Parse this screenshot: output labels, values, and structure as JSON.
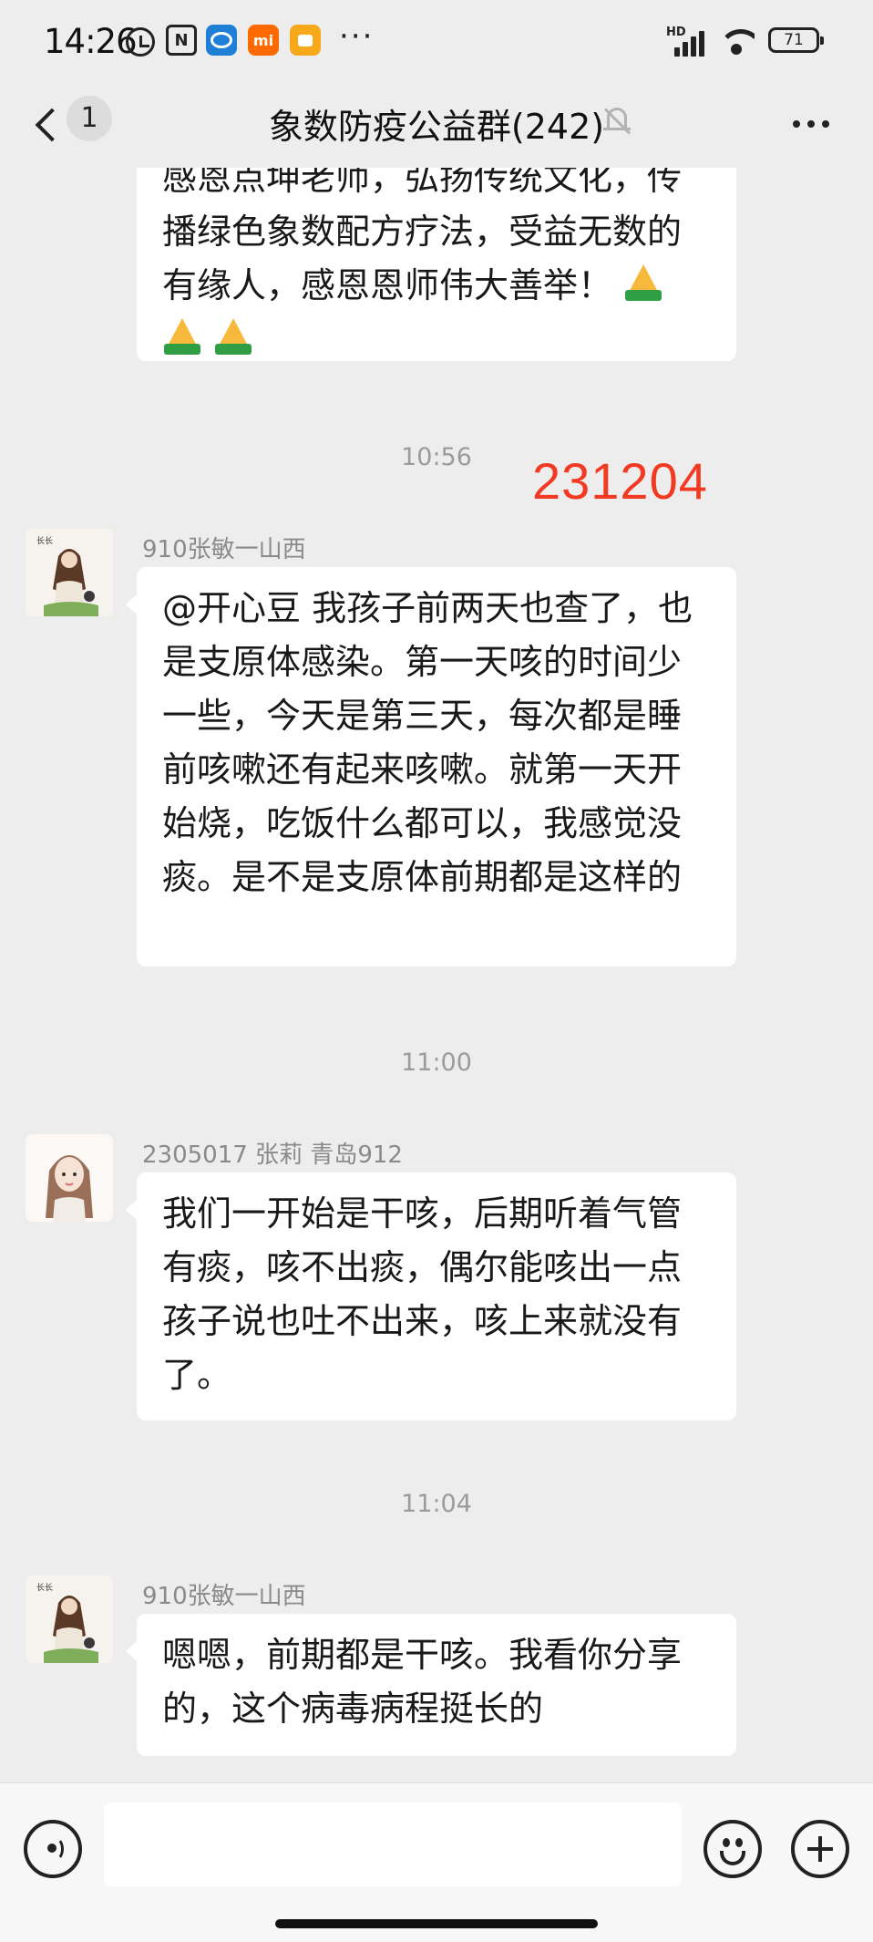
{
  "status_bar": {
    "time": "14:26",
    "nfc_label": "N",
    "app_label": "mi",
    "more": "···",
    "network_label": "HD",
    "battery": "71"
  },
  "nav": {
    "unread_count": "1",
    "title": "象数防疫公益群(242)"
  },
  "annotation": "231204",
  "messages": [
    {
      "type": "continuation",
      "lines": [
        "感恩点坤老师，弘扬传统文化，传",
        "播绿色象数配方疗法，受益无数的",
        "有缘人，感恩恩师伟大善举！"
      ]
    },
    {
      "type": "timestamp",
      "text": "10:56"
    },
    {
      "type": "message",
      "sender": "910张敏一山西",
      "text": "@开心豆  我孩子前两天也查了，也是支原体感染。第一天咳的时间少一些，今天是第三天，每次都是睡前咳嗽还有起来咳嗽。就第一天开始烧，吃饭什么都可以，我感觉没痰。是不是支原体前期都是这样的"
    },
    {
      "type": "timestamp",
      "text": "11:00"
    },
    {
      "type": "message",
      "sender": "2305017 张莉  青岛912",
      "text": "我们一开始是干咳，后期听着气管有痰，咳不出痰，偶尔能咳出一点孩子说也吐不出来，咳上来就没有了。"
    },
    {
      "type": "timestamp",
      "text": "11:04"
    },
    {
      "type": "message",
      "sender": "910张敏一山西",
      "text": "嗯嗯，前期都是干咳。我看你分享的，这个病毒病程挺长的"
    }
  ],
  "input": {
    "value": ""
  },
  "colors": {
    "background": "#ededed",
    "bubble": "#ffffff",
    "annotation": "#f23a22",
    "secondary_text": "#8a8a8a"
  },
  "icons": [
    "back-icon",
    "mute-icon",
    "more-icon",
    "voice-icon",
    "emoji-icon",
    "add-icon",
    "pray-emoji-icon"
  ]
}
